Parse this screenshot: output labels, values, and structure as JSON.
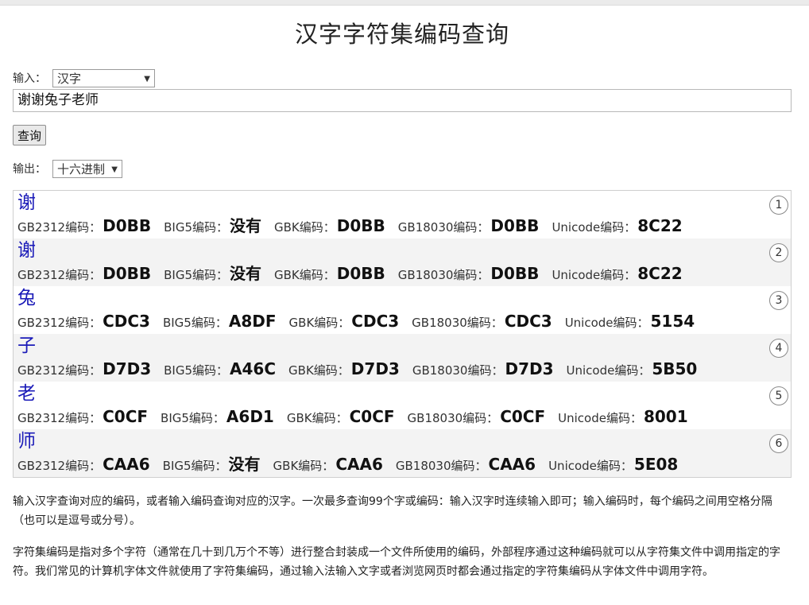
{
  "page": {
    "title": "汉字字符集编码查询"
  },
  "form": {
    "input_label": "输入：",
    "input_type_selected": "汉字",
    "query_value": "谢谢兔子老师",
    "query_button_label": "查询",
    "output_label": "输出：",
    "output_format_selected": "十六进制"
  },
  "code_labels": {
    "gb2312": "GB2312编码：",
    "big5": "BIG5编码：",
    "gbk": "GBK编码：",
    "gb18030": "GB18030编码：",
    "unicode": "Unicode编码："
  },
  "results": [
    {
      "index": "1",
      "char": "谢",
      "gb2312": "D0BB",
      "big5": "没有",
      "gbk": "D0BB",
      "gb18030": "D0BB",
      "unicode": "8C22"
    },
    {
      "index": "2",
      "char": "谢",
      "gb2312": "D0BB",
      "big5": "没有",
      "gbk": "D0BB",
      "gb18030": "D0BB",
      "unicode": "8C22"
    },
    {
      "index": "3",
      "char": "兔",
      "gb2312": "CDC3",
      "big5": "A8DF",
      "gbk": "CDC3",
      "gb18030": "CDC3",
      "unicode": "5154"
    },
    {
      "index": "4",
      "char": "子",
      "gb2312": "D7D3",
      "big5": "A46C",
      "gbk": "D7D3",
      "gb18030": "D7D3",
      "unicode": "5B50"
    },
    {
      "index": "5",
      "char": "老",
      "gb2312": "C0CF",
      "big5": "A6D1",
      "gbk": "C0CF",
      "gb18030": "C0CF",
      "unicode": "8001"
    },
    {
      "index": "6",
      "char": "师",
      "gb2312": "CAA6",
      "big5": "没有",
      "gbk": "CAA6",
      "gb18030": "CAA6",
      "unicode": "5E08"
    }
  ],
  "description": {
    "paragraph_1": "输入汉字查询对应的编码，或者输入编码查询对应的汉字。一次最多查询99个字或编码：输入汉字时连续输入即可；输入编码时，每个编码之间用空格分隔（也可以是逗号或分号）。",
    "paragraph_2": "字符集编码是指对多个字符（通常在几十到几万个不等）进行整合封装成一个文件所使用的编码，外部程序通过这种编码就可以从字符集文件中调用指定的字符。我们常见的计算机字体文件就使用了字符集编码，通过输入法输入文字或者浏览网页时都会通过指定的字符集编码从字体文件中调用字符。"
  }
}
